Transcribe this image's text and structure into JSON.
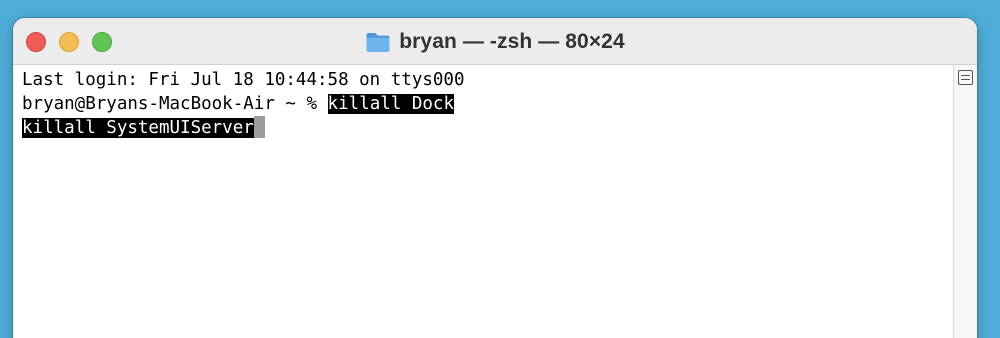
{
  "window": {
    "title": "bryan — -zsh — 80×24"
  },
  "terminal": {
    "line1": "Last login: Fri Jul 18 10:44:58 on ttys000",
    "prompt": "bryan@Bryans-MacBook-Air ~ % ",
    "command1": "killall Dock",
    "command2": "killall SystemUIServer"
  },
  "icons": {
    "title_icon": "folder-icon",
    "split_pane": "split-pane-icon"
  },
  "colors": {
    "desktop": "#4eaed9",
    "close": "#ee5c57",
    "minimize": "#f4bd4f",
    "zoom": "#61c454",
    "folder": "#5aa6e6",
    "selection": "#000000",
    "cursor": "#9b9b9b"
  }
}
